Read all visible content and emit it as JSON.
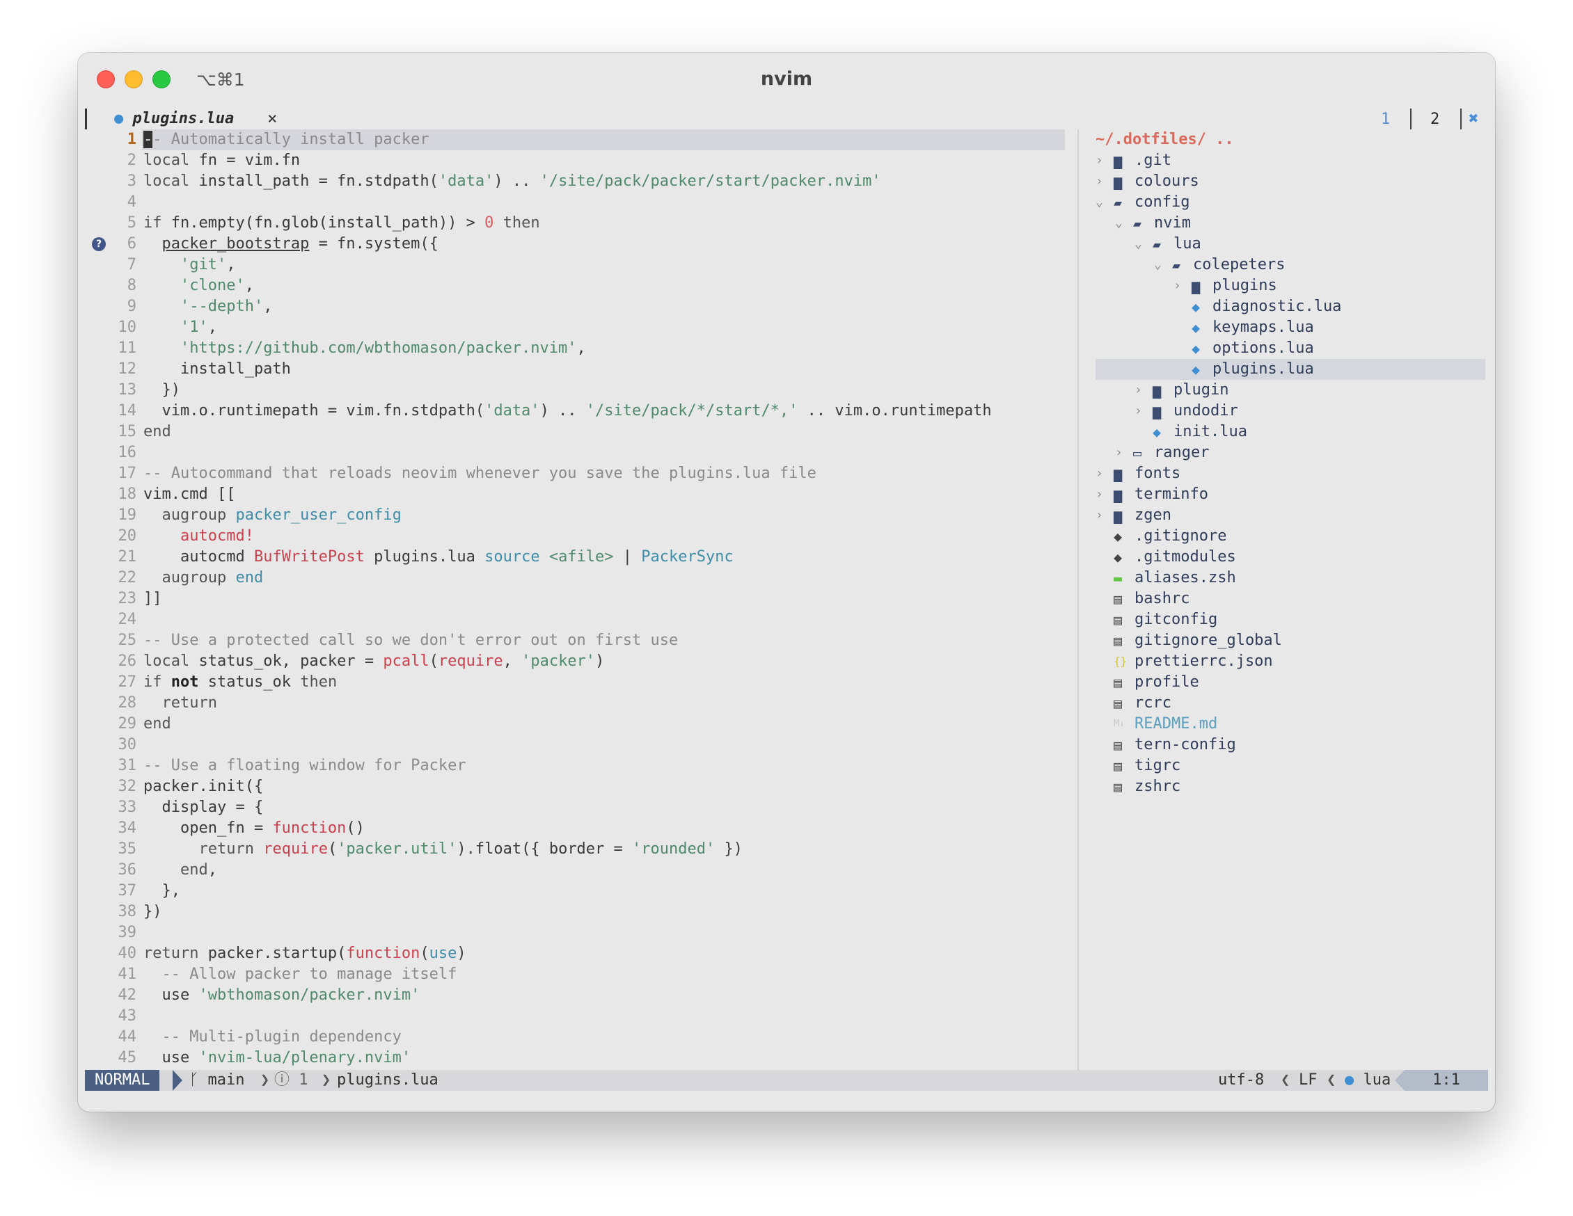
{
  "window": {
    "title": "nvim",
    "shortcut": "⌥⌘1"
  },
  "tabline": {
    "tab_label": "plugins.lua",
    "tab_icon": "lua-icon",
    "close_glyph": "×",
    "buffer_1": "1",
    "buffer_2": "2",
    "close_all_glyph": "✖"
  },
  "editor": {
    "lines": [
      "-- Automatically install packer",
      "local fn = vim.fn",
      "local install_path = fn.stdpath('data') .. '/site/pack/packer/start/packer.nvim'",
      "",
      "if fn.empty(fn.glob(install_path)) > 0 then",
      "  packer_bootstrap = fn.system({",
      "    'git',",
      "    'clone',",
      "    '--depth',",
      "    '1',",
      "    'https://github.com/wbthomason/packer.nvim',",
      "    install_path",
      "  })",
      "  vim.o.runtimepath = vim.fn.stdpath('data') .. '/site/pack/*/start/*,' .. vim.o.runtimepath",
      "end",
      "",
      "-- Autocommand that reloads neovim whenever you save the plugins.lua file",
      "vim.cmd [[",
      "  augroup packer_user_config",
      "    autocmd!",
      "    autocmd BufWritePost plugins.lua source <afile> | PackerSync",
      "  augroup end",
      "]]",
      "",
      "-- Use a protected call so we don't error out on first use",
      "local status_ok, packer = pcall(require, 'packer')",
      "if not status_ok then",
      "  return",
      "end",
      "",
      "-- Use a floating window for Packer",
      "packer.init({",
      "  display = {",
      "    open_fn = function()",
      "      return require('packer.util').float({ border = 'rounded' })",
      "    end,",
      "  },",
      "})",
      "",
      "return packer.startup(function(use)",
      "  -- Allow packer to manage itself",
      "  use 'wbthomason/packer.nvim'",
      "",
      "  -- Multi-plugin dependency",
      "  use 'nvim-lua/plenary.nvim'"
    ]
  },
  "tree": {
    "root": "~/.dotfiles/ ..",
    "items": [
      {
        "name": ".git",
        "depth": 0,
        "type": "folder",
        "open": false
      },
      {
        "name": "colours",
        "depth": 0,
        "type": "folder",
        "open": false
      },
      {
        "name": "config",
        "depth": 0,
        "type": "folder",
        "open": true
      },
      {
        "name": "nvim",
        "depth": 1,
        "type": "folder",
        "open": true
      },
      {
        "name": "lua",
        "depth": 2,
        "type": "folder",
        "open": true
      },
      {
        "name": "colepeters",
        "depth": 3,
        "type": "folder",
        "open": true
      },
      {
        "name": "plugins",
        "depth": 4,
        "type": "folder",
        "open": false
      },
      {
        "name": "diagnostic.lua",
        "depth": 4,
        "type": "lua"
      },
      {
        "name": "keymaps.lua",
        "depth": 4,
        "type": "lua"
      },
      {
        "name": "options.lua",
        "depth": 4,
        "type": "lua"
      },
      {
        "name": "plugins.lua",
        "depth": 4,
        "type": "lua",
        "selected": true
      },
      {
        "name": "plugin",
        "depth": 2,
        "type": "folder",
        "open": false
      },
      {
        "name": "undodir",
        "depth": 2,
        "type": "folder",
        "open": false
      },
      {
        "name": "init.lua",
        "depth": 2,
        "type": "lua"
      },
      {
        "name": "ranger",
        "depth": 1,
        "type": "folder-empty",
        "open": false
      },
      {
        "name": "fonts",
        "depth": 0,
        "type": "folder",
        "open": false
      },
      {
        "name": "terminfo",
        "depth": 0,
        "type": "folder",
        "open": false
      },
      {
        "name": "zgen",
        "depth": 0,
        "type": "folder",
        "open": false
      },
      {
        "name": ".gitignore",
        "depth": 0,
        "type": "git"
      },
      {
        "name": ".gitmodules",
        "depth": 0,
        "type": "git"
      },
      {
        "name": "aliases.zsh",
        "depth": 0,
        "type": "zsh"
      },
      {
        "name": "bashrc",
        "depth": 0,
        "type": "doc"
      },
      {
        "name": "gitconfig",
        "depth": 0,
        "type": "doc"
      },
      {
        "name": "gitignore_global",
        "depth": 0,
        "type": "doc"
      },
      {
        "name": "prettierrc.json",
        "depth": 0,
        "type": "json"
      },
      {
        "name": "profile",
        "depth": 0,
        "type": "doc"
      },
      {
        "name": "rcrc",
        "depth": 0,
        "type": "doc"
      },
      {
        "name": "README.md",
        "depth": 0,
        "type": "md"
      },
      {
        "name": "tern-config",
        "depth": 0,
        "type": "doc"
      },
      {
        "name": "tigrc",
        "depth": 0,
        "type": "doc"
      },
      {
        "name": "zshrc",
        "depth": 0,
        "type": "doc"
      }
    ]
  },
  "statusline": {
    "mode": "NORMAL",
    "branch": "main",
    "diagnostics": "1",
    "filename": "plugins.lua",
    "encoding": "utf-8",
    "format": "LF",
    "filetype": "lua",
    "position": "1:1"
  },
  "colors": {
    "mode_bg": "#4a5f82",
    "accent_blue": "#3f8fd2",
    "string": "#4f8a6a",
    "number": "#d95d5d"
  }
}
